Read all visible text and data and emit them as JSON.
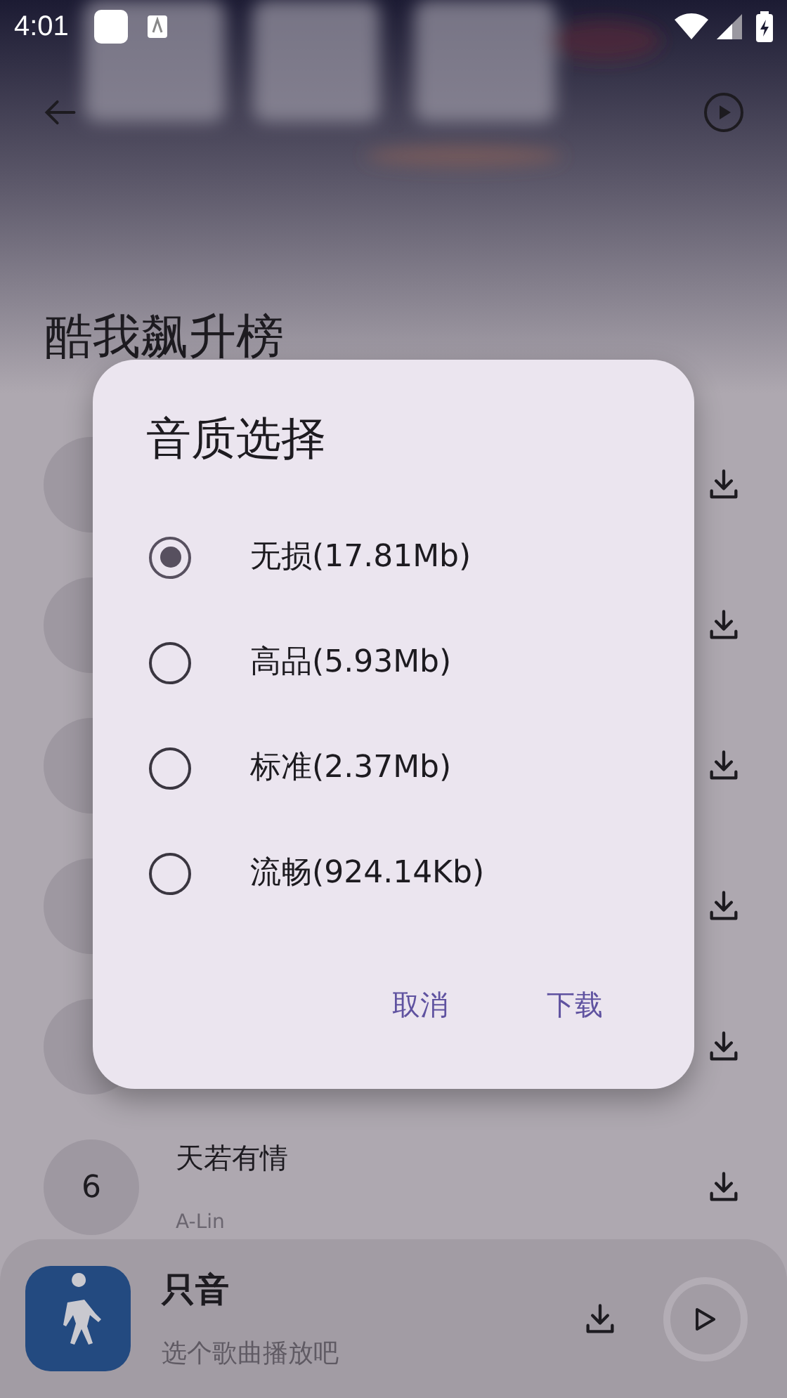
{
  "status_bar": {
    "time": "4:01"
  },
  "playlist_title": "酷我飙升榜",
  "songs": [
    {
      "kind": "covered"
    },
    {
      "kind": "covered"
    },
    {
      "kind": "covered"
    },
    {
      "kind": "covered"
    },
    {
      "kind": "covered"
    },
    {
      "kind": "song",
      "rank": "6",
      "title": "天若有情",
      "artist": "A-Lin"
    }
  ],
  "dialog": {
    "title": "音质选择",
    "options": [
      {
        "label": "无损(17.81Mb)",
        "selected": true
      },
      {
        "label": "高品(5.93Mb)",
        "selected": false
      },
      {
        "label": "标准(2.37Mb)",
        "selected": false
      },
      {
        "label": "流畅(924.14Kb)",
        "selected": false
      }
    ],
    "buttons": [
      "取消",
      "下载"
    ]
  },
  "player": {
    "title": "只音",
    "subtitle": "选个歌曲播放吧"
  }
}
